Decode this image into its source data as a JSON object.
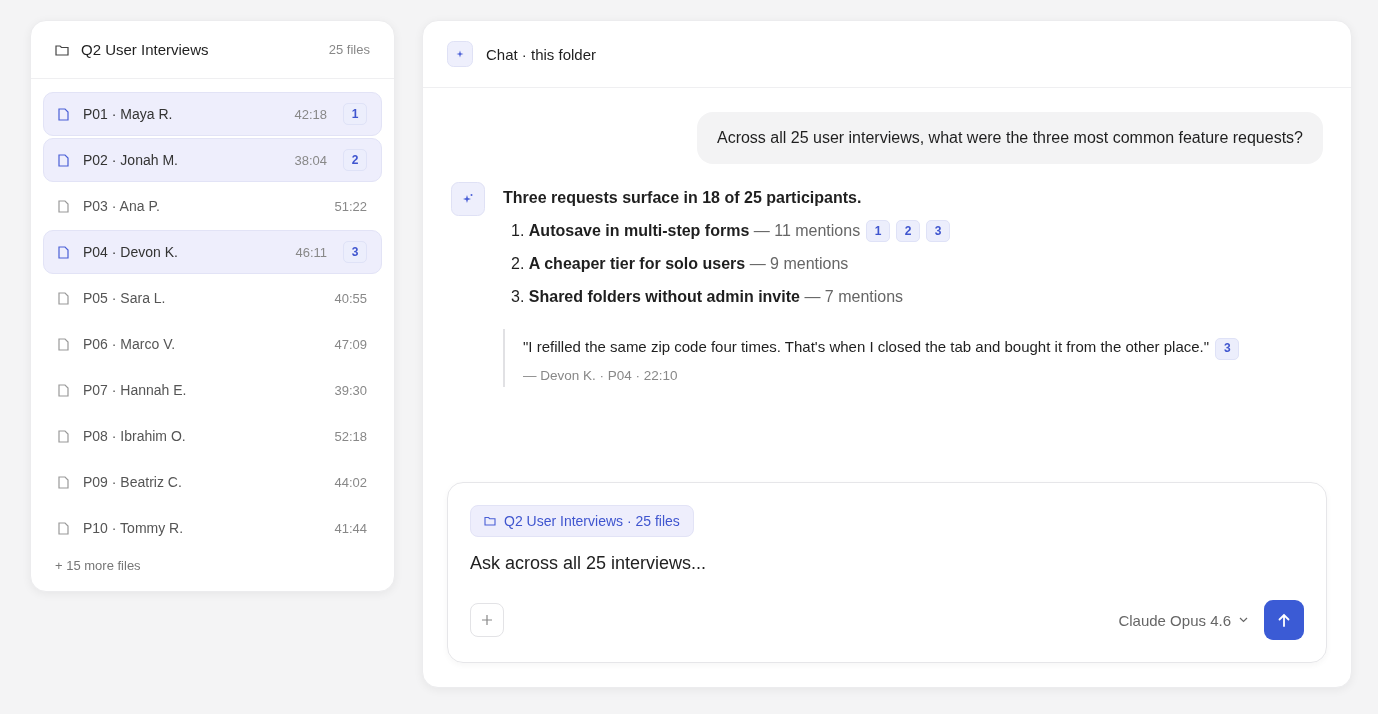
{
  "folder_panel": {
    "title": "Q2 User Interviews",
    "count": "25 files",
    "files": [
      {
        "name": "P01 · Maya R.",
        "duration": "42:18",
        "selected": true,
        "citation": "1"
      },
      {
        "name": "P02 · Jonah M.",
        "duration": "38:04",
        "selected": true,
        "citation": "2"
      },
      {
        "name": "P03 · Ana P.",
        "duration": "51:22",
        "selected": false
      },
      {
        "name": "P04 · Devon K.",
        "duration": "46:11",
        "selected": true,
        "citation": "3"
      },
      {
        "name": "P05 · Sara L.",
        "duration": "40:55",
        "selected": false
      },
      {
        "name": "P06 · Marco V.",
        "duration": "47:09",
        "selected": false
      },
      {
        "name": "P07 · Hannah E.",
        "duration": "39:30",
        "selected": false
      },
      {
        "name": "P08 · Ibrahim O.",
        "duration": "52:18",
        "selected": false
      },
      {
        "name": "P09 · Beatriz C.",
        "duration": "44:02",
        "selected": false
      },
      {
        "name": "P10 · Tommy R.",
        "duration": "41:44",
        "selected": false
      }
    ],
    "more": "+ 15 more files"
  },
  "chat": {
    "title": "Chat · this folder",
    "user_message": "Across all 25 user interviews, what were the three most common feature requests?",
    "answer": {
      "summary": "Three requests surface in 18 of 25 participants.",
      "items": [
        {
          "number": "1.",
          "title": "Autosave in multi-step forms",
          "detail": "— 11 mentions",
          "citations": [
            "1",
            "2",
            "3"
          ]
        },
        {
          "number": "2.",
          "title": "A cheaper tier for solo users",
          "detail": "— 9 mentions"
        },
        {
          "number": "3.",
          "title": "Shared folders without admin invite",
          "detail": "— 7 mentions"
        }
      ],
      "quote": {
        "text": "\"I refilled the same zip code four times. That's when I closed the tab and bought it from the other place.\"",
        "citation": "3",
        "source": "— Devon K. · P04 · 22:10"
      }
    }
  },
  "composer": {
    "context_chip": "Q2 User Interviews · 25 files",
    "placeholder": "Ask across all 25 interviews...",
    "model": "Claude Opus 4.6"
  }
}
